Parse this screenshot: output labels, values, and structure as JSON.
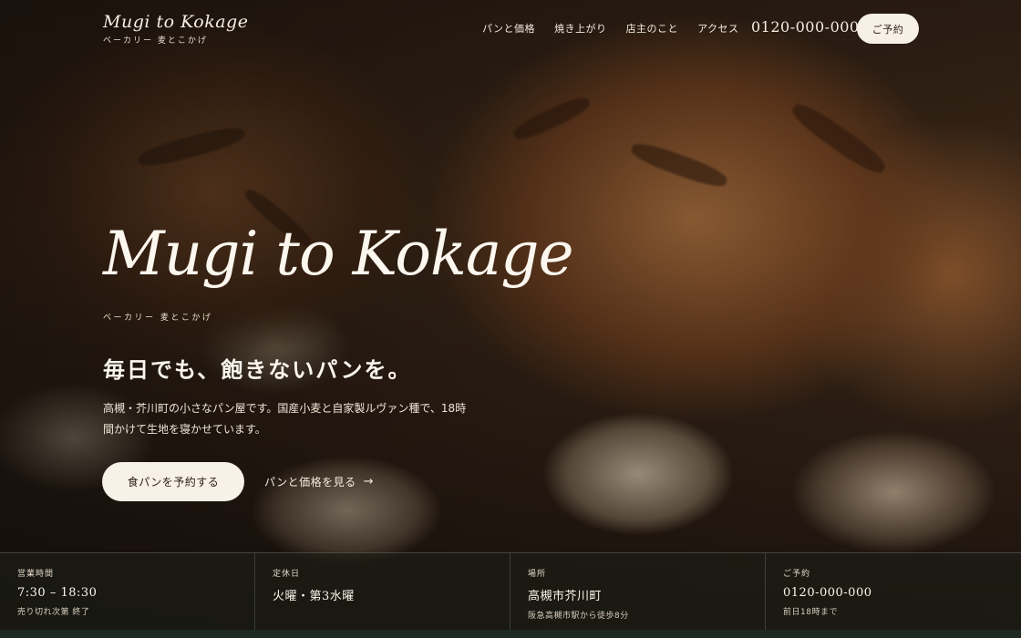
{
  "header": {
    "brand_name": "Mugi to Kokage",
    "brand_sub": "ベーカリー 麦とこかげ",
    "nav": [
      "パンと価格",
      "焼き上がり",
      "店主のこと",
      "アクセス"
    ],
    "phone": "0120-000-000",
    "reserve_label": "ご予約"
  },
  "hero": {
    "title": "Mugi to Kokage",
    "kana": "ベーカリー 麦とこかげ",
    "tagline": "毎日でも、飽きないパンを。",
    "description": "高槻・芥川町の小さなパン屋です。国産小麦と自家製ルヴァン種で、18時間かけて生地を寝かせています。",
    "primary_button": "食パンを予約する",
    "secondary_link": "パンと価格を見る",
    "secondary_arrow": "→"
  },
  "info": [
    {
      "label": "営業時間",
      "value": "7:30 – 18:30",
      "note": "売り切れ次第 終了"
    },
    {
      "label": "定休日",
      "value": "火曜・第3水曜",
      "note": ""
    },
    {
      "label": "場所",
      "value": "高槻市芥川町",
      "note": "阪急高槻市駅から徒歩8分"
    },
    {
      "label": "ご予約",
      "value": "0120-000-000",
      "note": "前日18時まで"
    }
  ]
}
